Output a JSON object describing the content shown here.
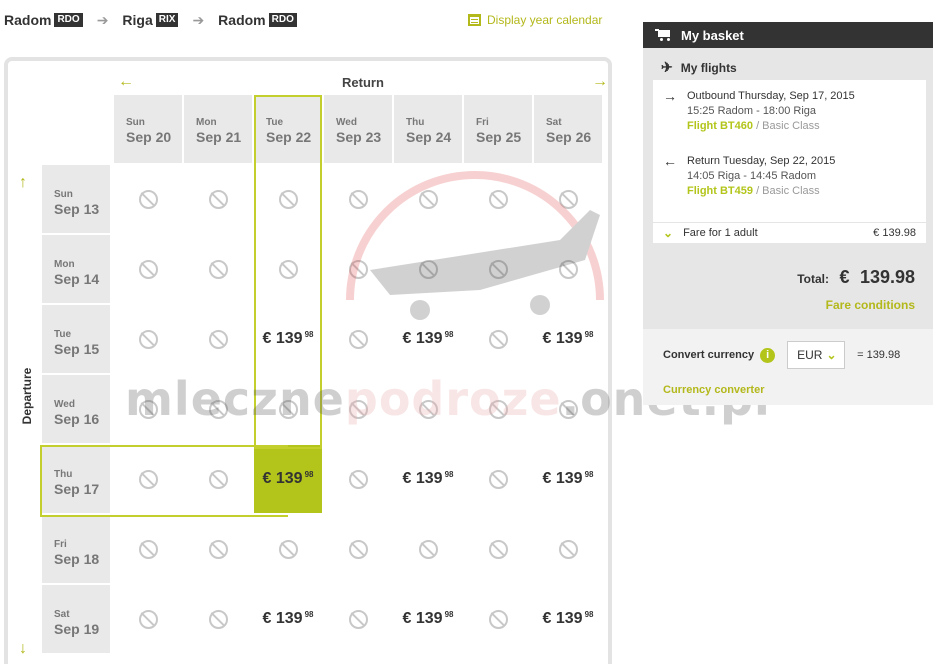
{
  "route": [
    {
      "city": "Radom",
      "code": "RDO"
    },
    {
      "city": "Riga",
      "code": "RIX"
    },
    {
      "city": "Radom",
      "code": "RDO"
    }
  ],
  "year_calendar_label": "Display year calendar",
  "calendar": {
    "return_label": "Return",
    "departure_label": "Departure",
    "columns": [
      {
        "dow": "Sun",
        "date": "Sep 20"
      },
      {
        "dow": "Mon",
        "date": "Sep 21"
      },
      {
        "dow": "Tue",
        "date": "Sep 22"
      },
      {
        "dow": "Wed",
        "date": "Sep 23"
      },
      {
        "dow": "Thu",
        "date": "Sep 24"
      },
      {
        "dow": "Fri",
        "date": "Sep 25"
      },
      {
        "dow": "Sat",
        "date": "Sep 26"
      }
    ],
    "rows": [
      {
        "dow": "Sun",
        "date": "Sep 13",
        "cells": [
          "na",
          "na",
          "na",
          "na",
          "na",
          "na",
          "na"
        ]
      },
      {
        "dow": "Mon",
        "date": "Sep 14",
        "cells": [
          "na",
          "na",
          "na",
          "na",
          "na",
          "na",
          "na"
        ]
      },
      {
        "dow": "Tue",
        "date": "Sep 15",
        "cells": [
          "na",
          "na",
          "fare",
          "na",
          "fare",
          "na",
          "fare"
        ]
      },
      {
        "dow": "Wed",
        "date": "Sep 16",
        "cells": [
          "na",
          "na",
          "na",
          "na",
          "na",
          "na",
          "na"
        ]
      },
      {
        "dow": "Thu",
        "date": "Sep 17",
        "cells": [
          "na",
          "na",
          "sel",
          "na",
          "fare",
          "na",
          "fare"
        ]
      },
      {
        "dow": "Fri",
        "date": "Sep 18",
        "cells": [
          "na",
          "na",
          "na",
          "na",
          "na",
          "na",
          "na"
        ]
      },
      {
        "dow": "Sat",
        "date": "Sep 19",
        "cells": [
          "na",
          "na",
          "fare",
          "na",
          "fare",
          "na",
          "fare"
        ]
      }
    ],
    "fare_amount": "€ 139",
    "fare_cents": "98",
    "selected": {
      "row": 4,
      "col": 2
    }
  },
  "basket": {
    "title": "My basket",
    "my_flights": "My flights",
    "outbound": {
      "title": "Outbound Thursday, Sep 17, 2015",
      "times": "15:25 Radom - 18:00 Riga",
      "flight": "Flight BT460",
      "class": " / Basic Class"
    },
    "return": {
      "title": "Return Tuesday, Sep 22, 2015",
      "times": "14:05 Riga - 14:45 Radom",
      "flight": "Flight BT459",
      "class": " / Basic Class"
    },
    "fare_for": "Fare for 1 adult",
    "fare_for_value": "€  139.98",
    "total_label": "Total:",
    "total_currency": "€",
    "total_value": "139.98",
    "fare_conditions": "Fare conditions",
    "convert_label": "Convert currency",
    "currency": "EUR",
    "converted": "= 139.98",
    "currency_converter": "Currency converter"
  },
  "watermark": {
    "part1": "mleczne",
    "part2": "podroze",
    "part3": ".onet.pl"
  },
  "colors": {
    "accent": "#b3c51b",
    "dark": "#333333",
    "header_bg": "#e9e9e9"
  }
}
